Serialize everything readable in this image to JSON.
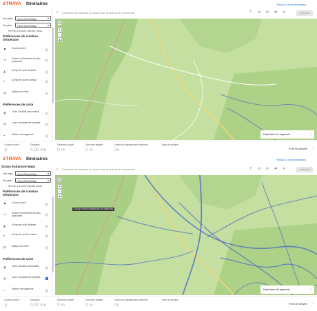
{
  "brand": "STRAVA",
  "app_title": "Itinéraires",
  "back_link": "Retour à mes itinéraires",
  "enhanced_label": "Strava Enhanced Maps",
  "plans": [
    {
      "label": "1er plan",
      "value": "OpenStreetMap"
    },
    {
      "label": "2e plan",
      "value": "OpenStreetMap"
    }
  ],
  "reset_label": "Revenir à la carte originale strava",
  "creation_prefs_title": "Préférences de création d'itinéraire",
  "creation_options": [
    {
      "icon": "run-icon",
      "label": "Course à pied"
    },
    {
      "icon": "route-popular-icon",
      "label": "Suivre les itinéraires les plus populaires"
    },
    {
      "icon": "elevation-icon",
      "label": "Ai importe quel dénivelé"
    },
    {
      "icon": "surface-icon",
      "label": "Ai importe quelle surface"
    },
    {
      "icon": "segments-icon",
      "label": "Masquer le relief"
    }
  ],
  "map_prefs_title": "Préférences de carte",
  "map_options_1": [
    {
      "icon": "heatmap-icon",
      "label": "Carte d'activité personnelle",
      "checked": false
    },
    {
      "icon": "global-heatmap-icon",
      "label": "Carte mondiale des activités",
      "checked": false
    },
    {
      "icon": "segment-icon",
      "label": "Afficher les segments",
      "checked": false
    }
  ],
  "map_options_2": [
    {
      "icon": "heatmap-icon",
      "label": "Carte d'activité personnelle",
      "checked": false
    },
    {
      "icon": "global-heatmap-icon",
      "label": "Carte mondiale des activités",
      "checked": true
    },
    {
      "icon": "segment-icon",
      "label": "Afficher les segments",
      "checked": false
    }
  ],
  "search_placeholder": "Cherchez une adresse ou cliquez sur la carte pour commencer",
  "itinerary_button": "Itinéraire",
  "segment_explorer": "Explorateur de segments",
  "tooltip": "CLIQUEZ POUR COMMENCER UN ITINÉRAIRE",
  "stats": [
    {
      "label": "Course à pied",
      "value": ""
    },
    {
      "label": "Distance",
      "value": "0,00 km"
    },
    {
      "label": "Dénivelé positif",
      "value": "0 m"
    },
    {
      "label": "Dénivelé négatif",
      "value": "0 m"
    },
    {
      "label": "Durée de déplacement estimée",
      "value": "0s"
    },
    {
      "label": "Type de surface",
      "value": ""
    }
  ],
  "profile_label": "Profil de dénivelé",
  "colors": {
    "brand": "#fc4c02",
    "map_green": "#bfdc9a",
    "heat_blue": "#4666c8",
    "link": "#1f6fd0"
  }
}
